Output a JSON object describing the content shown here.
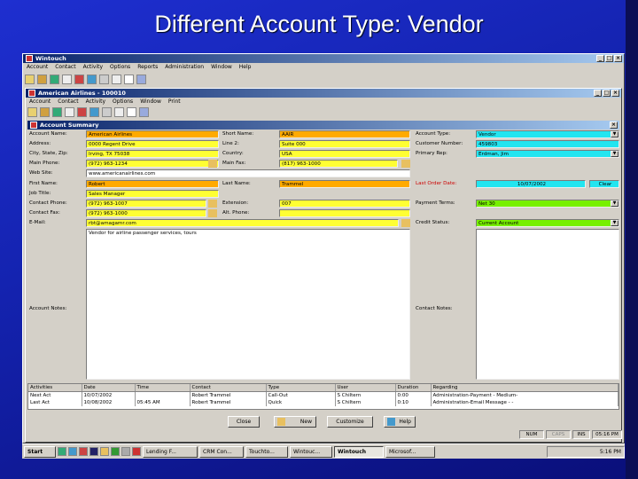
{
  "slide_title": "Different Account Type: Vendor",
  "app": {
    "title": "Wintouch",
    "menu": [
      "Account",
      "Contact",
      "Activity",
      "Options",
      "Reports",
      "Administration",
      "Window",
      "Help"
    ]
  },
  "account_window": {
    "title": "American Airlines - 100010",
    "menu": [
      "Account",
      "Contact",
      "Activity",
      "Options",
      "Window",
      "Print"
    ]
  },
  "summary": {
    "title": "Account Summary"
  },
  "fields": {
    "account_name": {
      "label": "Account Name:",
      "value": "American Airlines"
    },
    "address": {
      "label": "Address:",
      "value": "0000 Regent Drive"
    },
    "city": {
      "label": "City, State, Zip:",
      "value": "Irving, TX 75038"
    },
    "main_phone": {
      "label": "Main Phone:",
      "value": "(972) 963-1234"
    },
    "web_site": {
      "label": "Web Site:",
      "value": "www.americanairlines.com"
    },
    "first_name": {
      "label": "First Name:",
      "value": "Robert"
    },
    "job_title": {
      "label": "Job Title:",
      "value": "Sales Manager"
    },
    "contact_phone": {
      "label": "Contact Phone:",
      "value": "(972) 963-1007"
    },
    "contact_fax": {
      "label": "Contact Fax:",
      "value": "(972) 963-1000"
    },
    "email": {
      "label": "E-Mail:",
      "value": "rbt@amagamr.com"
    },
    "short_name": {
      "label": "Short Name:",
      "value": "AAIR"
    },
    "line2": {
      "label": "Line 2:",
      "value": "Suite 000"
    },
    "country": {
      "label": "Country:",
      "value": "USA"
    },
    "main_fax": {
      "label": "Main Fax:",
      "value": "(817) 963-1000"
    },
    "last_name": {
      "label": "Last Name:",
      "value": "Trammel"
    },
    "extension": {
      "label": "Extension:",
      "value": "007"
    },
    "alt_phone": {
      "label": "Alt. Phone:",
      "value": ""
    },
    "account_type": {
      "label": "Account Type:",
      "value": "Vendor"
    },
    "customer_number": {
      "label": "Customer Number:",
      "value": "459803"
    },
    "primary_rep": {
      "label": "Primary Rep:",
      "value": "Erdman, Jim"
    },
    "last_order_date": {
      "label": "Last Order Date:",
      "value": "10/07/2002"
    },
    "clear_label": "Clear",
    "payment_terms": {
      "label": "Payment Terms:",
      "value": "Net 30"
    },
    "credit_status": {
      "label": "Credit Status:",
      "value": "Current Account"
    },
    "notes_text": "Vendor for airline passenger services, tours",
    "account_notes_label": "Account Notes:",
    "contact_notes_label": "Contact Notes:"
  },
  "activities": {
    "columns": [
      "Activities",
      "Date",
      "Time",
      "Contact",
      "Type",
      "User",
      "Duration",
      "Regarding"
    ],
    "rows": [
      [
        "Next Act",
        "10/07/2002",
        "",
        "Robert Trammel",
        "Call-Out",
        "S Chiltern",
        "0:00",
        "Administration-Payment - Medium-"
      ],
      [
        "Last Act",
        "10/08/2002",
        "05:45 AM",
        "Robert Trammel",
        "Quick",
        "S Chiltern",
        "0:10",
        "Administration-Email Message - -"
      ]
    ]
  },
  "buttons": {
    "close": "Close",
    "new": "New",
    "customize": "Customize",
    "help": "Help"
  },
  "status": {
    "num": "NUM",
    "caps": "CAPS",
    "ins": "INS",
    "time": "05:16 PM"
  },
  "taskbar": {
    "start": "Start",
    "items": [
      "Lending F...",
      "CRM Con...",
      "Touchto...",
      "Wintouc...",
      "Wintouch",
      "Microsof..."
    ],
    "clock": "5:16 PM"
  },
  "colors": {
    "yellow": "#ffff33",
    "orange": "#ffaa00",
    "cyan": "#22e5f0",
    "green": "#77f000"
  }
}
